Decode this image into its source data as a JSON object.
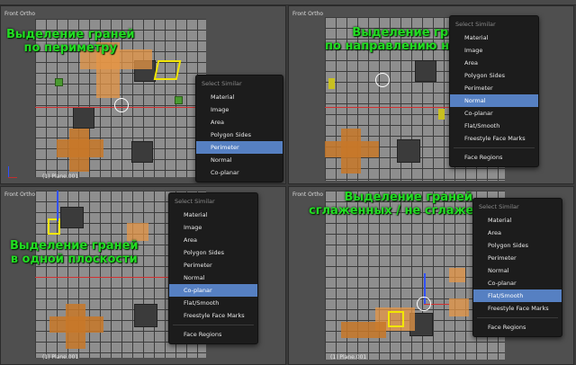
{
  "panels": [
    {
      "view_title": "Front Ortho",
      "object_label": "(1) Plane.001",
      "overlay_lines": [
        "Выделение граней",
        "по периметру"
      ],
      "menu": {
        "title": "Select Similar",
        "items": [
          "Material",
          "Image",
          "Area",
          "Polygon Sides",
          "Perimeter",
          "Normal",
          "Co-planar"
        ],
        "selected": "Perimeter",
        "footer_items": []
      }
    },
    {
      "view_title": "Front Ortho",
      "object_label": "",
      "overlay_lines": [
        "Выделение граней",
        "по направлению нормалей"
      ],
      "menu": {
        "title": "Select Similar",
        "items": [
          "Material",
          "Image",
          "Area",
          "Polygon Sides",
          "Perimeter",
          "Normal",
          "Co-planar",
          "Flat/Smooth",
          "Freestyle Face Marks"
        ],
        "selected": "Normal",
        "footer_items": [
          "Face Regions"
        ]
      }
    },
    {
      "view_title": "Front Ortho",
      "object_label": "(1) Plane.001",
      "overlay_lines": [
        "Выделение граней",
        "в одной плоскости"
      ],
      "menu": {
        "title": "Select Similar",
        "items": [
          "Material",
          "Image",
          "Area",
          "Polygon Sides",
          "Perimeter",
          "Normal",
          "Co-planar",
          "Flat/Smooth",
          "Freestyle Face Marks"
        ],
        "selected": "Co-planar",
        "footer_items": [
          "Face Regions"
        ]
      }
    },
    {
      "view_title": "Front Ortho",
      "object_label": "(1) Plane.001",
      "overlay_lines": [
        "Выделение граней",
        "сглаженных / не сглаженных"
      ],
      "menu": {
        "title": "Select Similar",
        "items": [
          "Material",
          "Area",
          "Polygon Sides",
          "Perimeter",
          "Normal",
          "Co-planar",
          "Flat/Smooth",
          "Freestyle Face Marks"
        ],
        "selected": "Flat/Smooth",
        "footer_items": [
          "Face Regions"
        ]
      }
    }
  ],
  "colors": {
    "overlay_text": "#22dd22",
    "menu_highlight": "#5680c2",
    "selection_box": "#f2e600",
    "selected_faces": "#e69646"
  }
}
